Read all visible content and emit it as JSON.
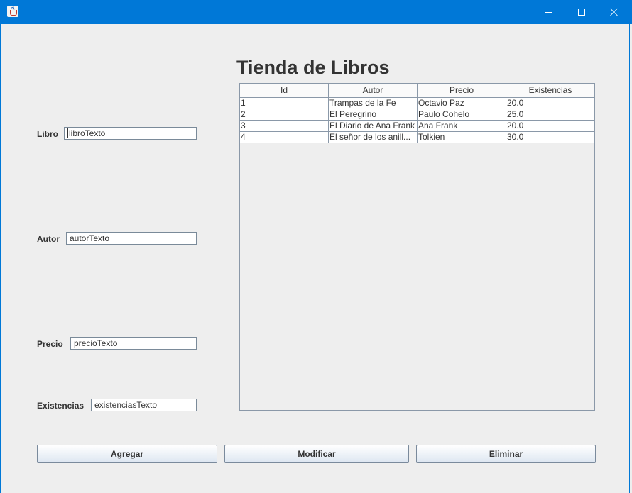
{
  "window": {
    "title": "",
    "icon": "java-coffee-cup-icon"
  },
  "page": {
    "title": "Tienda de Libros"
  },
  "form": {
    "libro": {
      "label": "Libro",
      "value": "libroTexto"
    },
    "autor": {
      "label": "Autor",
      "value": "autorTexto"
    },
    "precio": {
      "label": "Precio",
      "value": "precioTexto"
    },
    "existencias": {
      "label": "Existencias",
      "value": "existenciasTexto"
    }
  },
  "table": {
    "headers": [
      "Id",
      "Autor",
      "Precio",
      "Existencias"
    ],
    "rows": [
      [
        "1",
        "Trampas de la Fe",
        "Octavio Paz",
        "20.0"
      ],
      [
        "2",
        "El Peregrino",
        "Paulo Cohelo",
        "25.0"
      ],
      [
        "3",
        "El Diario de Ana Frank",
        "Ana Frank",
        "20.0"
      ],
      [
        "4",
        "El señor de los anill...",
        "Tolkien",
        "30.0"
      ]
    ]
  },
  "buttons": {
    "agregar": "Agregar",
    "modificar": "Modificar",
    "eliminar": "Eliminar"
  },
  "colors": {
    "titlebar": "#0078d7",
    "background": "#eeeeee"
  }
}
